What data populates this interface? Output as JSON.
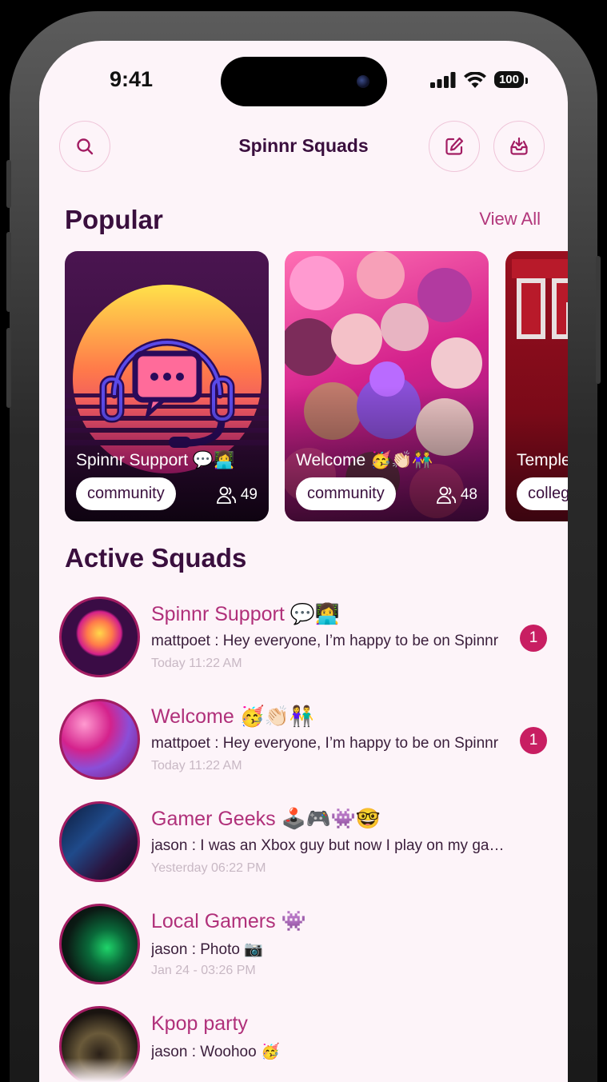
{
  "status_bar": {
    "time": "9:41",
    "battery": "100"
  },
  "header": {
    "title": "Spinnr Squads"
  },
  "popular": {
    "title": "Popular",
    "view_all": "View All",
    "cards": [
      {
        "title": "Spinnr Support 💬👩‍💻",
        "tag": "community",
        "members": "49"
      },
      {
        "title": "Welcome 🥳👏🏻👫",
        "tag": "community",
        "members": "48"
      },
      {
        "title": "Temple",
        "tag": "college"
      }
    ]
  },
  "active": {
    "title": "Active Squads",
    "squads": [
      {
        "name": "Spinnr Support 💬👩‍💻",
        "message": "mattpoet : Hey everyone, I’m happy to be on Spinnr",
        "time": "Today 11:22 AM",
        "unread": "1"
      },
      {
        "name": "Welcome 🥳👏🏻👫",
        "message": "mattpoet : Hey everyone, I’m happy to be on Spinnr",
        "time": "Today 11:22 AM",
        "unread": "1"
      },
      {
        "name": "Gamer Geeks 🕹️🎮👾🤓",
        "message": "jason : I was an Xbox guy but now I play on my gaming PC",
        "time": "Yesterday 06:22 PM"
      },
      {
        "name": "Local Gamers 👾",
        "message": "jason : Photo 📷",
        "time": "Jan 24 - 03:26 PM"
      },
      {
        "name": "Kpop party",
        "message": "jason : Woohoo 🥳",
        "time": ""
      }
    ]
  },
  "colors": {
    "accent": "#b0307a",
    "badge": "#c81e62",
    "title": "#3a0f3e",
    "background": "#fdf4f9"
  },
  "icons": [
    "search-icon",
    "compose-icon",
    "inbox-icon",
    "members-icon",
    "signal-icon",
    "wifi-icon"
  ]
}
